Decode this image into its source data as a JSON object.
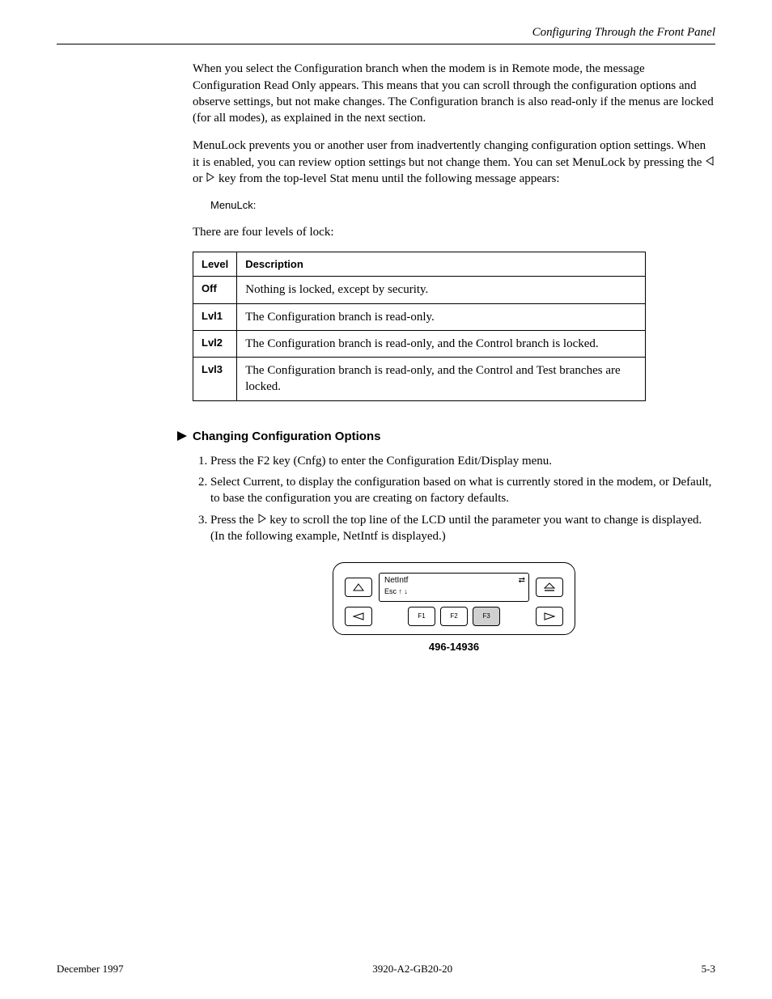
{
  "header": {
    "title": "Configuring Through the Front Panel"
  },
  "intro": "When you select the Configuration branch when the modem is in Remote mode, the message Configuration Read Only appears. This means that you can scroll through the configuration options and observe settings, but not make changes. The Configuration branch is also read-only if the menus are locked (for all modes), as explained in the next section.",
  "menulock": {
    "p1_a": "MenuLock prevents you or another user from inadvertently changing configuration option settings. When it is enabled, you can review option settings but not change them. You can set MenuLock by pressing the ",
    "p1_b": " or ",
    "p1_c": " key from the top-level Stat menu until the following message appears:",
    "msg": "MenuLck:",
    "p2": "There are four levels of lock:",
    "table": {
      "headers": [
        "Level",
        "Description"
      ],
      "rows": [
        {
          "level": "Off",
          "desc": "Nothing is locked, except by security."
        },
        {
          "level": "Lvl1",
          "desc": "The Configuration branch is read-only."
        },
        {
          "level": "Lvl2",
          "desc": "The Configuration branch is read-only, and the Control branch is locked."
        },
        {
          "level": "Lvl3",
          "desc": "The Configuration branch is read-only, and the Control and Test branches are locked."
        }
      ]
    }
  },
  "changing": {
    "heading": "Changing Configuration Options",
    "steps": [
      "Press the F2 key (Cnfg) to enter the Configuration Edit/Display menu.",
      "Select Current, to display the configuration based on what is currently stored in the modem, or Default, to base the configuration you are creating on factory defaults.",
      {
        "a": "Press the ",
        "b": " key to scroll the top line of the LCD until the parameter you want to change is displayed. (In the following example, NetIntf is displayed.)"
      }
    ]
  },
  "panel": {
    "screen_line1": "NetIntf",
    "screen_line2": "Esc ↑ ↓",
    "screen_symbol": "⇄",
    "buttons": {
      "top_left_icon": "triangle-up",
      "top_right_icon": "eject",
      "bottom_left_icon": "triangle-left-outline",
      "f1": "F1",
      "f2": "F2",
      "f3": "F3",
      "bottom_right_icon": "triangle-right-outline"
    },
    "caption": "496-14936"
  },
  "footer": {
    "left": "December 1997",
    "center": "3920-A2-GB20-20",
    "right": "5-3"
  }
}
